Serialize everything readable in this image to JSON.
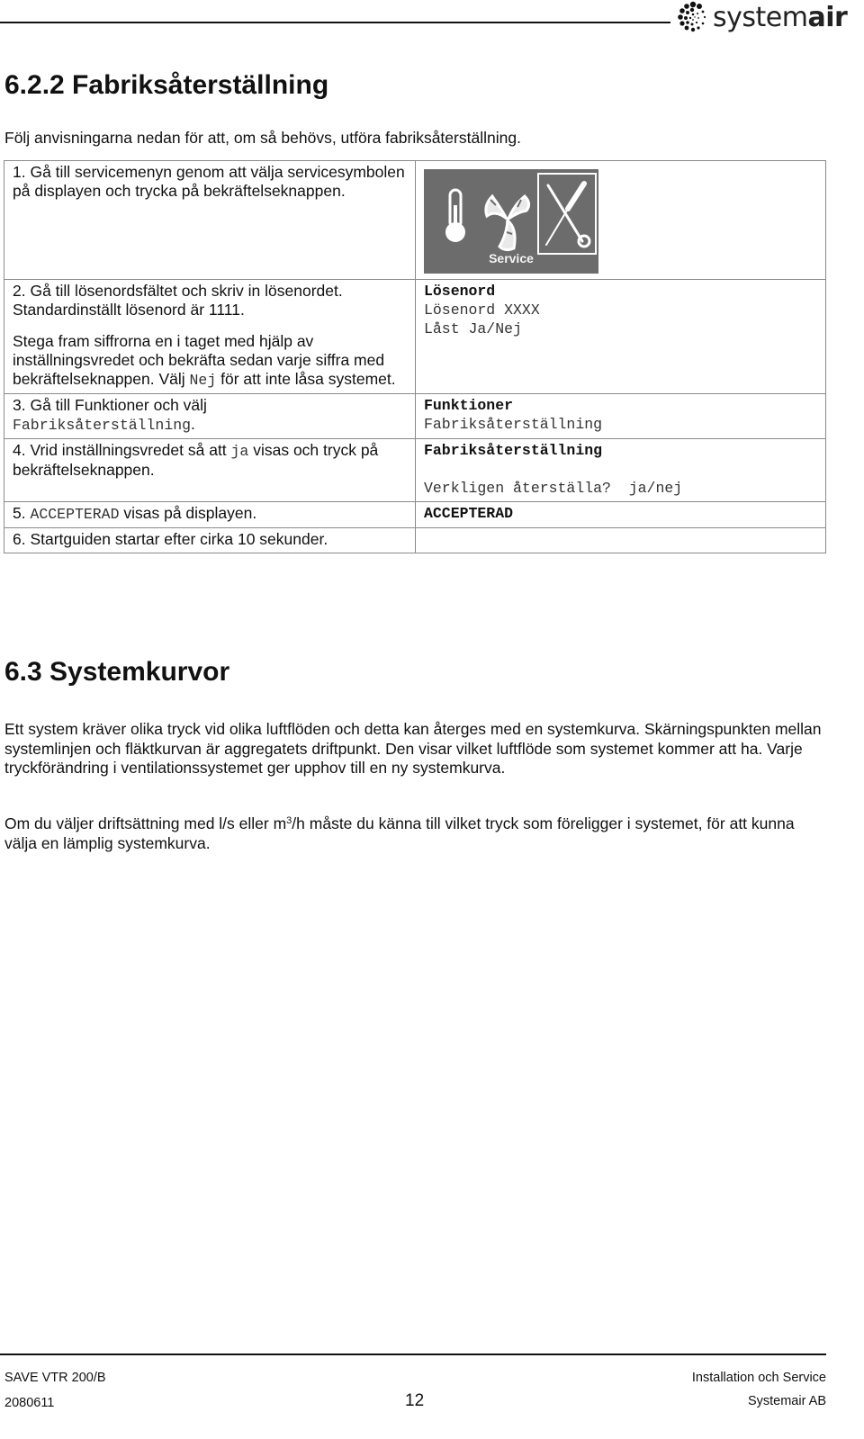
{
  "header": {
    "logo_text_light": "system",
    "logo_text_bold": "air",
    "logo_icon": "systemair-dot-spiral-icon"
  },
  "section_622": {
    "title": "6.2.2 Fabriksåterställning",
    "intro": "Följ anvisningarna nedan för att, om så behövs, utföra fabriksåterställning.",
    "steps": [
      {
        "text": "1.  Gå till servicemenyn genom att välja servicesymbolen på displayen och trycka på bekräftelseknappen.",
        "display": {
          "type": "icon-panel",
          "icons": [
            "thermometer-icon",
            "fan-icon",
            "service-tools-icon"
          ],
          "selected_icon": "service-tools-icon",
          "label": "Service",
          "panel_color": "#6c6c6c"
        }
      },
      {
        "text_a": "2. Gå till lösenordsfältet och skriv in lösenordet. Standardinställt lösenord är 1111.",
        "text_b_pre": "Stega fram siffrorna en i taget med hjälp av inställningsvredet och bekräfta sedan varje siffra med bekräftelseknappen. Välj ",
        "text_b_code": "Nej",
        "text_b_post": " för att inte låsa systemet.",
        "display": {
          "heading": "Lösenord",
          "lines": [
            "Lösenord XXXX",
            "Låst Ja/Nej"
          ]
        }
      },
      {
        "text_pre": "3.  Gå till Funktioner och välj",
        "text_code": "Fabriksåterställning",
        "text_post": ".",
        "display": {
          "heading": "Funktioner",
          "lines": [
            "Fabriksåterställning"
          ]
        }
      },
      {
        "text_pre": "4. Vrid inställningsvredet så att ",
        "text_code": "ja",
        "text_post": " visas och tryck på bekräftelseknappen.",
        "display": {
          "heading": "Fabriksåterställning",
          "lines": [
            "Verkligen återställa?  ja/nej"
          ]
        }
      },
      {
        "text_pre": "5. ",
        "text_code": "ACCEPTERAD",
        "text_post": " visas på displayen.",
        "display": {
          "heading": "ACCEPTERAD",
          "lines": []
        }
      },
      {
        "text": "6. Startguiden startar efter cirka 10 sekunder.",
        "display": null
      }
    ]
  },
  "section_63": {
    "title": "6.3 Systemkurvor",
    "paragraph_1": "Ett system kräver olika tryck vid olika luftflöden och detta kan återges med en systemkurva. Skärningspunkten mellan systemlinjen och fläktkurvan är aggregatets driftpunkt. Den visar vilket luftflöde som systemet kommer att ha. Varje tryckförändring i ventilationssystemet ger upphov till en ny systemkurva.",
    "paragraph_2_pre": "Om du väljer driftsättning med l/s eller m",
    "paragraph_2_sup": "3",
    "paragraph_2_post": "/h måste du känna till vilket tryck som föreligger i systemet, för att kunna välja en lämplig systemkurva."
  },
  "footer": {
    "model": "SAVE VTR 200/B",
    "doc_number": "2080611",
    "page_number": "12",
    "manual_title": "Installation och Service",
    "company": "Systemair AB"
  }
}
